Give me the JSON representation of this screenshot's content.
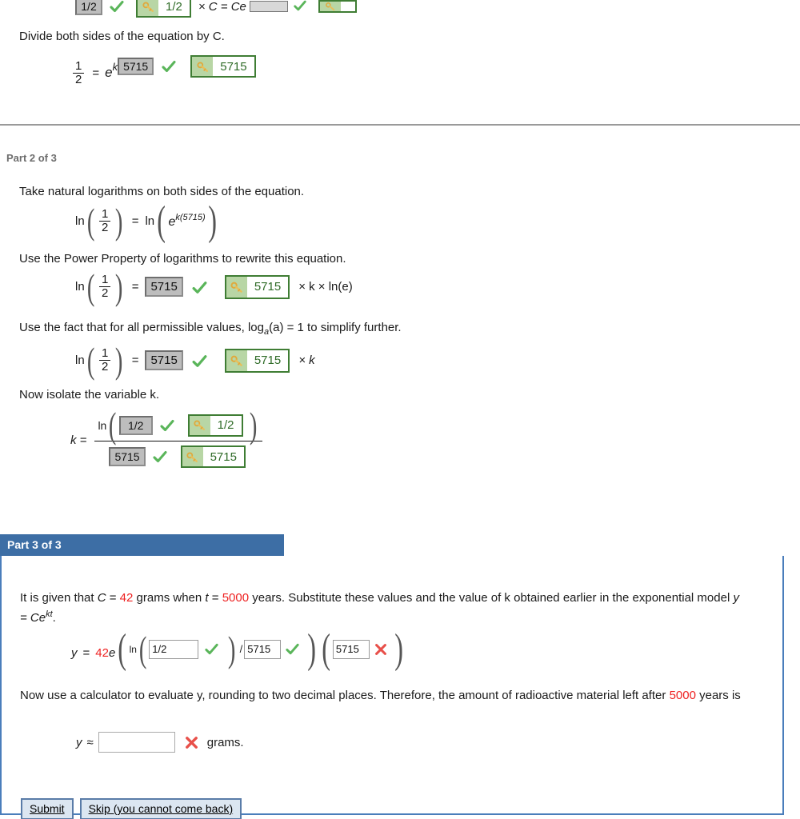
{
  "part1_tail": {
    "eq_top": {
      "gray_answer": "1/2",
      "key_answer": "1/2",
      "trailing_text": "× C = Ce",
      "exponent_input_value": "",
      "exponent_key_value": ""
    },
    "instruction": "Divide both sides of the equation by C.",
    "eq_divide": {
      "lhs_num": "1",
      "lhs_den": "2",
      "equals": "=",
      "base": "e",
      "exp_var": "k",
      "gray_answer": "5715",
      "key_answer": "5715"
    }
  },
  "part2": {
    "label": "Part 2 of 3",
    "instruction_1": "Take natural logarithms on both sides of the equation.",
    "eq_ln": {
      "ln": "ln",
      "num": "1",
      "den": "2",
      "equals": "=",
      "rhs_ln": "ln",
      "rhs_base": "e",
      "rhs_exponent": "k(5715)"
    },
    "instruction_2": "Use the Power Property of logarithms to rewrite this equation.",
    "eq_power": {
      "ln": "ln",
      "num": "1",
      "den": "2",
      "equals": "=",
      "gray_answer": "5715",
      "key_answer": "5715",
      "tail": "× k × ln(e)"
    },
    "instruction_3_a": "Use the fact that for all permissible values, log",
    "instruction_3_sub": "a",
    "instruction_3_b": "(a) = 1 to simplify further.",
    "eq_simplify": {
      "ln": "ln",
      "num": "1",
      "den": "2",
      "equals": "=",
      "gray_answer": "5715",
      "key_answer": "5715",
      "tail": "× k"
    },
    "instruction_4": "Now isolate the variable k.",
    "eq_isolate": {
      "lhs": "k  =",
      "num_ln": "ln",
      "num_gray_answer": "1/2",
      "num_key_answer": "1/2",
      "den_gray_answer": "5715",
      "den_key_answer": "5715"
    }
  },
  "part3": {
    "label": "Part 3 of 3",
    "statement_pre": "It is given that ",
    "statement_c_var": "C",
    "statement_eq1": " = ",
    "statement_c_value": "42",
    "statement_mid": " grams when ",
    "statement_t_var": "t",
    "statement_eq2": " = ",
    "statement_t_value": "5000",
    "statement_post": " years. Substitute these values and the value of k obtained earlier in the exponential model ",
    "statement_model_y": "y",
    "statement_model_eq": " = Ce",
    "statement_model_exp": "kt",
    "statement_model_end": ".",
    "eq_substitute": {
      "y": "y",
      "equals": "=",
      "coef": "42",
      "base": "e",
      "ln": "ln",
      "input_1": "1/2",
      "divider": "/",
      "input_2": "5715",
      "input_3": "5715"
    },
    "instruction_eval": "Now use a calculator to evaluate y, rounding to two decimal places. Therefore, the amount of radioactive",
    "instruction_eval_2_pre": "material left after ",
    "instruction_eval_years": "5000",
    "instruction_eval_2_post": " years is",
    "final_answer": {
      "y": "y",
      "approx": "≈",
      "value": "",
      "units": "grams."
    },
    "buttons": {
      "submit": "Submit",
      "skip": "Skip (you cannot come back)"
    }
  },
  "colors": {
    "part_tab_blue": "#3d6ea5",
    "part_box_border": "#4a7ebb",
    "highlight_red": "#ee2222",
    "check_green": "#5ab55a",
    "x_red": "#e8504a",
    "key_green_border": "#3f7d34",
    "key_pad_green": "#b8d6a5",
    "gray_box": "#bdbdbd"
  },
  "icons": {
    "check": "check-icon",
    "cross": "cross-icon",
    "key": "key-icon"
  }
}
